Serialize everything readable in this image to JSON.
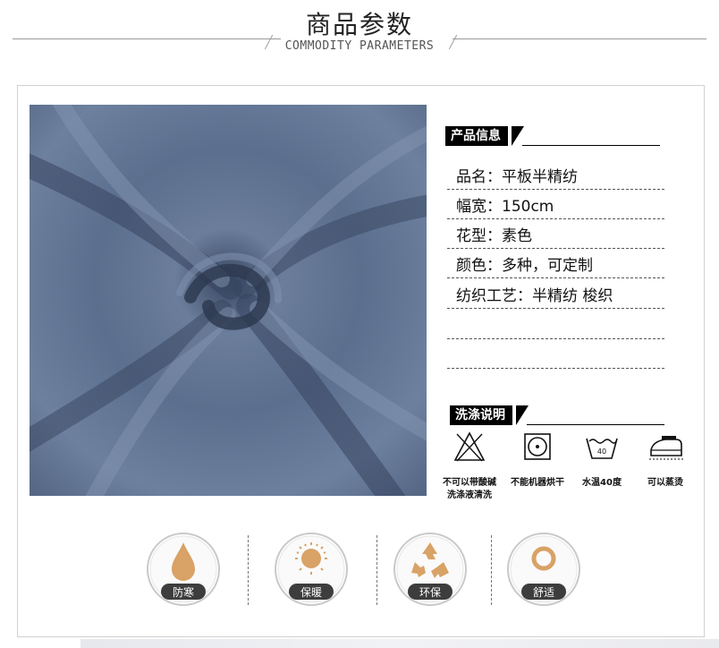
{
  "header": {
    "title": "商品参数",
    "subtitle": "COMMODITY PARAMETERS"
  },
  "product_info": {
    "heading": "产品信息",
    "rows": [
      "品名：平板半精纺",
      "幅宽：150cm",
      "花型：素色",
      "颜色：多种，可定制",
      "纺织工艺：半精纺   梭织",
      "",
      ""
    ]
  },
  "care": {
    "heading": "洗涤说明",
    "items": [
      {
        "icon": "no-bleach-triangle-icon",
        "label_line1": "不可以带酸碱",
        "label_line2": "洗涤液清洗"
      },
      {
        "icon": "no-tumble-dry-icon",
        "label_line1": "不能机器烘干",
        "label_line2": ""
      },
      {
        "icon": "wash-tub-40-icon",
        "label_line1": "水温40度",
        "label_line2": ""
      },
      {
        "icon": "steam-iron-icon",
        "label_line1": "可以蒸烫",
        "label_line2": ""
      }
    ],
    "tub_temp": "40"
  },
  "features": [
    {
      "icon": "water-drop-icon",
      "label": "防寒"
    },
    {
      "icon": "sun-icon",
      "label": "保暖"
    },
    {
      "icon": "recycle-icon",
      "label": "环保"
    },
    {
      "icon": "ring-icon",
      "label": "舒适"
    }
  ],
  "colors": {
    "tag_bg": "#000000",
    "fabric": "#5b6f8e",
    "feature_icon": "#d9a266",
    "label_badge": "#3d3d3d"
  }
}
